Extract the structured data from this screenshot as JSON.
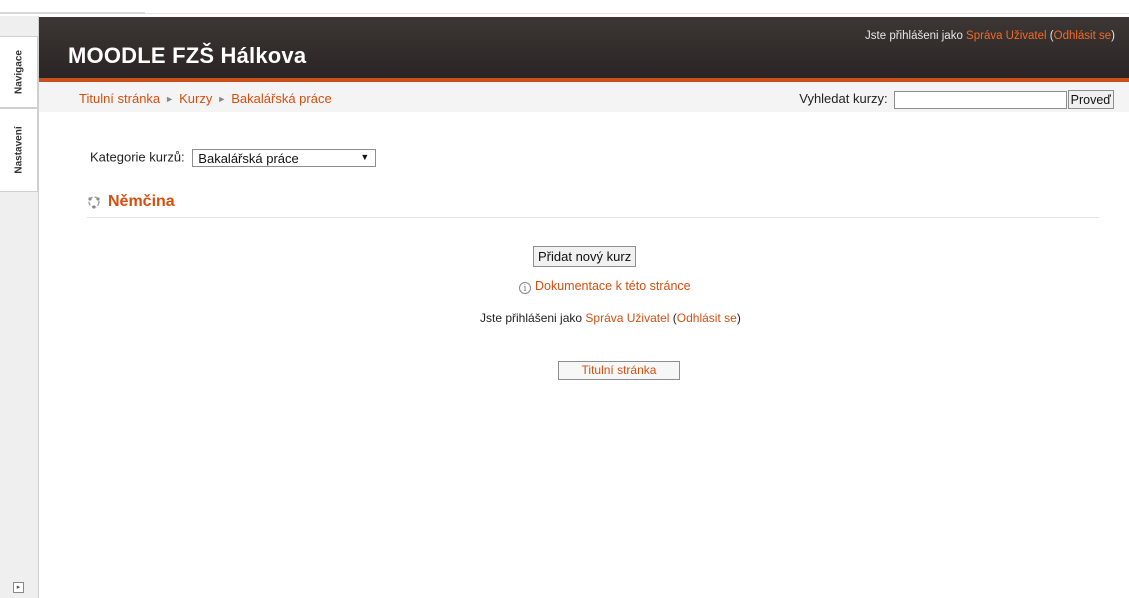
{
  "dock": {
    "tabs": [
      {
        "label": "Navigace"
      },
      {
        "label": "Nastavení"
      }
    ]
  },
  "header": {
    "site_title": "MOODLE FZŠ Hálkova",
    "login_prefix": "Jste přihlášeni jako ",
    "user_name": "Správa Uživatel",
    "logout_open": " (",
    "logout_label": "Odhlásit se",
    "logout_close": ")"
  },
  "navbar": {
    "breadcrumb": [
      {
        "label": "Titulní stránka"
      },
      {
        "label": "Kurzy"
      },
      {
        "label": "Bakalářská práce"
      }
    ],
    "separator": "►",
    "search_label": "Vyhledat kurzy:",
    "search_value": "",
    "search_button": "Proveď"
  },
  "main": {
    "category_label": "Kategorie kurzů:",
    "category_selected": "Bakalářská práce",
    "section_title": "Němčina",
    "add_course_button": "Přidat nový kurz",
    "doc_icon": "i",
    "doc_link": "Dokumentace k této stránce",
    "footer_login_prefix": "Jste přihlášeni jako ",
    "footer_user_name": "Správa Uživatel",
    "footer_logout_open": " (",
    "footer_logout_label": "Odhlásit se",
    "footer_logout_close": ")",
    "home_button": "Titulní stránka"
  },
  "colors": {
    "accent": "#d84e0f",
    "header_bg": "#2f2a29",
    "header_border": "#c9501a"
  }
}
